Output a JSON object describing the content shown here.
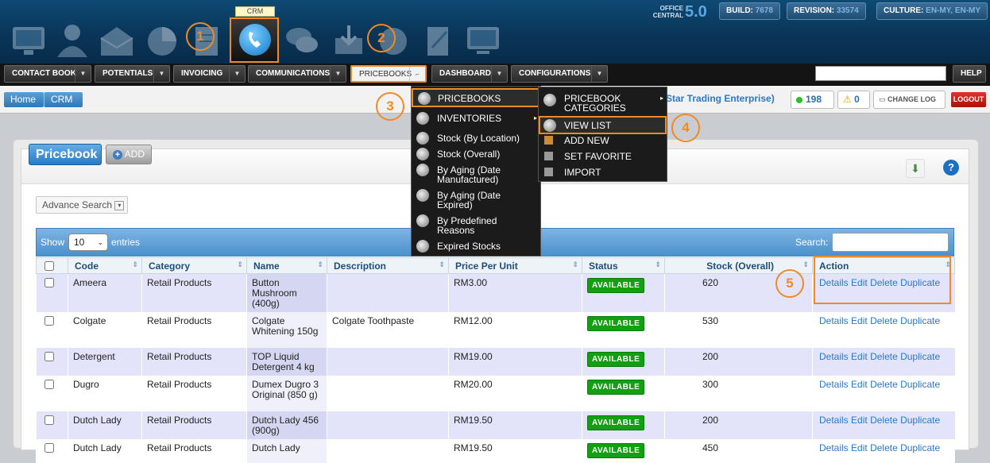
{
  "header": {
    "app_label": "CRM",
    "office_small": "OFFICE\nCENTRAL",
    "office_version": "5.0",
    "build_label": "BUILD:",
    "build_value": "7678",
    "revision_label": "REVISION:",
    "revision_value": "33574",
    "culture_label": "CULTURE:",
    "culture_value": "EN-MY, EN-MY"
  },
  "menu": {
    "items": [
      "CONTACT BOOK",
      "POTENTIALS",
      "INVOICING",
      "COMMUNICATIONS",
      "PRICEBOOKS",
      "DASHBOARD",
      "CONFIGURATIONS"
    ],
    "help": "HELP",
    "search_value": ""
  },
  "breadcrumb": {
    "home": "Home",
    "crm": "CRM"
  },
  "topright": {
    "company_fragment": "Star Trading Enterprise)",
    "count_green": "198",
    "count_warning": "0",
    "change_log": "CHANGE LOG",
    "logout": "LOGOUT"
  },
  "pricebook_menu": {
    "items": [
      "PRICEBOOKS",
      "INVENTORIES",
      "Stock (By Location)",
      "Stock (Overall)",
      "By Aging (Date Manufactured)",
      "By Aging (Date Expired)",
      "By Predefined Reasons",
      "Expired Stocks"
    ]
  },
  "submenu": {
    "items": [
      "PRICEBOOK CATEGORIES",
      "VIEW LIST",
      "ADD NEW",
      "SET FAVORITE",
      "IMPORT"
    ]
  },
  "callouts": [
    "1",
    "2",
    "3",
    "4",
    "5"
  ],
  "page": {
    "title": "Pricebook",
    "add_label": "ADD",
    "advance_search": "Advance Search",
    "show_label": "Show",
    "show_value": "10",
    "entries_label": "entries",
    "search_label": "Search:"
  },
  "table": {
    "columns": [
      "Code",
      "Category",
      "Name",
      "Description",
      "Price Per Unit",
      "Status",
      "Stock (Overall)",
      "Action"
    ],
    "rows": [
      {
        "code": "Ameera",
        "category": "Retail Products",
        "name": "Button Mushroom (400g)",
        "description": "",
        "price": "RM3.00",
        "status": "AVAILABLE",
        "stock": "620"
      },
      {
        "code": "Colgate",
        "category": "Retail Products",
        "name": "Colgate Whitening 150g",
        "description": "Colgate Toothpaste",
        "price": "RM12.00",
        "status": "AVAILABLE",
        "stock": "530"
      },
      {
        "code": "Detergent",
        "category": "Retail Products",
        "name": "TOP Liquid Detergent 4 kg",
        "description": "",
        "price": "RM19.00",
        "status": "AVAILABLE",
        "stock": "200"
      },
      {
        "code": "Dugro",
        "category": "Retail Products",
        "name": "Dumex Dugro 3 Original (850 g)",
        "description": "",
        "price": "RM20.00",
        "status": "AVAILABLE",
        "stock": "300"
      },
      {
        "code": "Dutch Lady",
        "category": "Retail Products",
        "name": "Dutch Lady 456 (900g)",
        "description": "",
        "price": "RM19.50",
        "status": "AVAILABLE",
        "stock": "200"
      },
      {
        "code": "Dutch Lady",
        "category": "Retail Products",
        "name": "Dutch Lady",
        "description": "",
        "price": "RM19.50",
        "status": "AVAILABLE",
        "stock": "450"
      }
    ],
    "actions": [
      "Details",
      "Edit",
      "Delete",
      "Duplicate"
    ]
  }
}
